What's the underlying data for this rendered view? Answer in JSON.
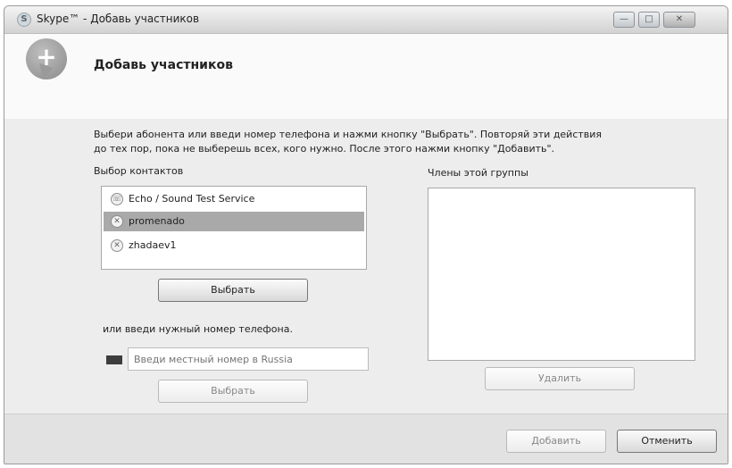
{
  "window": {
    "title": "Skype™ - Добавь участников",
    "title_icon": "S",
    "controls": {
      "minimize": "—",
      "maximize": "□",
      "close": "✕"
    }
  },
  "header": {
    "heading": "Добавь участников",
    "logo_icon": "add-contact-icon",
    "plus": "+"
  },
  "instructions": {
    "line1": "Выбери абонента или введи номер телефона и нажми кнопку \"Выбрать\". Повторяй эти действия",
    "line2": "до тех пор, пока не выберешь всех, кого нужно. После этого нажми кнопку \"Добавить\"."
  },
  "contacts": {
    "label": "Выбор контактов",
    "items": [
      {
        "name": "Echo / Sound Test Service",
        "icon": "echo-icon",
        "selected": false
      },
      {
        "name": "promenado",
        "icon": "contact-icon",
        "selected": true
      },
      {
        "name": "zhadaev1",
        "icon": "contact-icon",
        "selected": false
      }
    ],
    "select_button": "Выбрать"
  },
  "phone": {
    "label": "или введи нужный номер телефона.",
    "placeholder": "Введи местный номер в Russia",
    "select_button": "Выбрать"
  },
  "members": {
    "label": "Члены этой группы",
    "delete_button": "Удалить"
  },
  "footer": {
    "add_button": "Добавить",
    "cancel_button": "Отменить"
  }
}
